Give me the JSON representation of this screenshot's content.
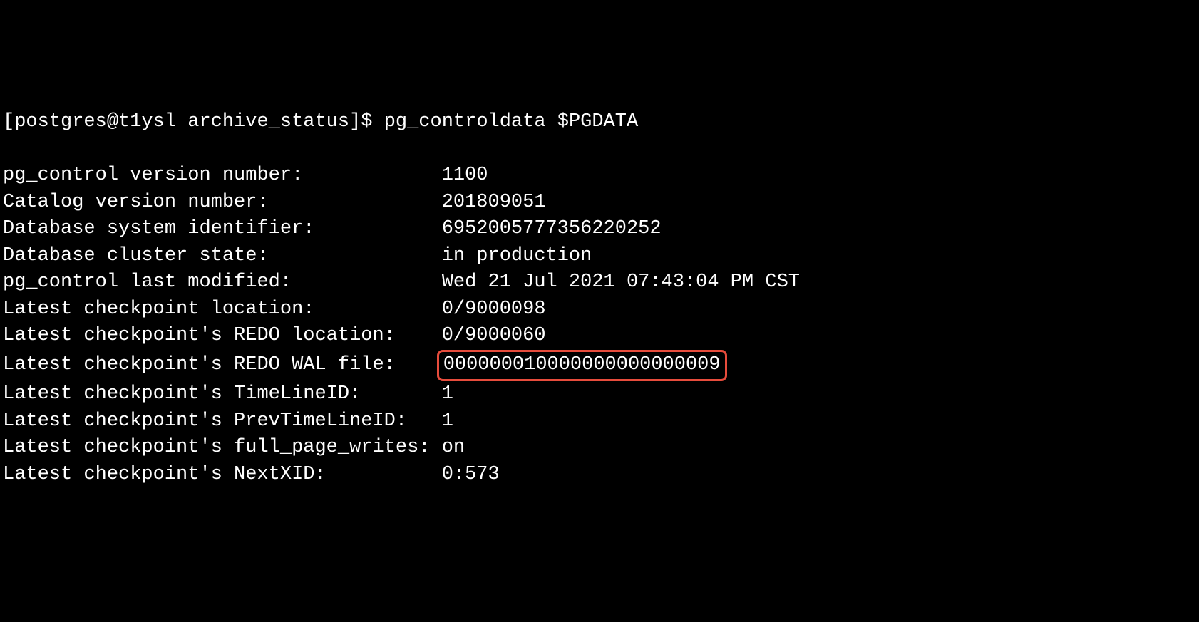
{
  "prompt": {
    "user": "postgres",
    "host": "t1ysl",
    "cwd": "archive_status",
    "symbol": "$",
    "command": "pg_controldata $PGDATA"
  },
  "rows": [
    {
      "label": "pg_control version number:            ",
      "value": "1100",
      "highlight": false
    },
    {
      "label": "Catalog version number:               ",
      "value": "201809051",
      "highlight": false
    },
    {
      "label": "Database system identifier:           ",
      "value": "6952005777356220252",
      "highlight": false
    },
    {
      "label": "Database cluster state:               ",
      "value": "in production",
      "highlight": false
    },
    {
      "label": "pg_control last modified:             ",
      "value": "Wed 21 Jul 2021 07:43:04 PM CST",
      "highlight": false
    },
    {
      "label": "Latest checkpoint location:           ",
      "value": "0/9000098",
      "highlight": false
    },
    {
      "label": "Latest checkpoint's REDO location:    ",
      "value": "0/9000060",
      "highlight": false
    },
    {
      "label": "Latest checkpoint's REDO WAL file:    ",
      "value": "000000010000000000000009",
      "highlight": true
    },
    {
      "label": "Latest checkpoint's TimeLineID:       ",
      "value": "1",
      "highlight": false
    },
    {
      "label": "Latest checkpoint's PrevTimeLineID:   ",
      "value": "1",
      "highlight": false
    },
    {
      "label": "Latest checkpoint's full_page_writes: ",
      "value": "on",
      "highlight": false
    },
    {
      "label": "Latest checkpoint's NextXID:          ",
      "value": "0:573",
      "highlight": false
    }
  ]
}
